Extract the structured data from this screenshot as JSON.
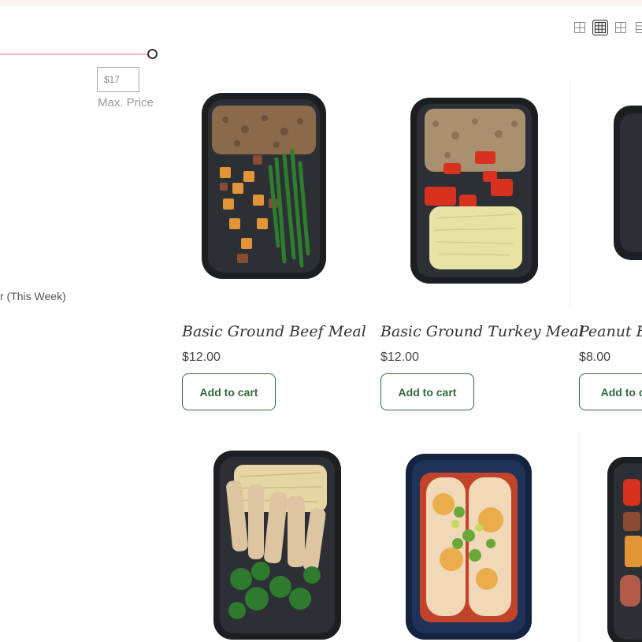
{
  "filter": {
    "max_price_value": "$17",
    "max_price_label": "Max. Price",
    "category_label": "r (This Week)"
  },
  "view_options": [
    "grid-2-icon",
    "grid-3-icon",
    "grid-4-icon",
    "list-icon"
  ],
  "products": [
    {
      "name": "Basic Ground Beef Meal",
      "price": "$12.00",
      "cta": "Add to cart"
    },
    {
      "name": "Basic Ground Turkey Meal",
      "price": "$12.00",
      "cta": "Add to cart"
    },
    {
      "name": "Peanut Bu",
      "price": "$8.00",
      "cta": "Add to ca"
    }
  ],
  "colors": {
    "accent": "#2f6b3b",
    "slider": "#f2b8bd"
  }
}
